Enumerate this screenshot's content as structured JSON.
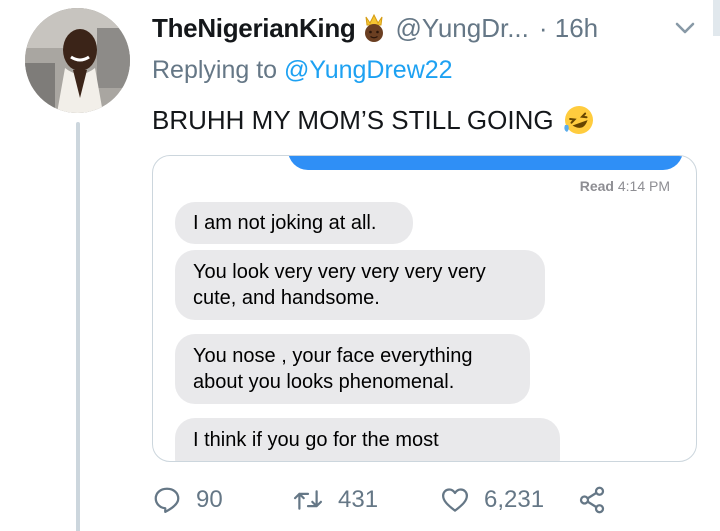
{
  "tweet": {
    "display_name": "TheNigerianKing",
    "name_emoji": "crown-person-emoji",
    "handle": "@YungDr...",
    "time": "· 16h",
    "replying_prefix": "Replying to",
    "replying_to": "@YungDrew22",
    "text": "BRUHH MY MOM’S STILL GOING",
    "text_emoji": "laughing-crying-emoji"
  },
  "screenshot": {
    "read_label": "Read",
    "read_time": "4:14 PM",
    "messages": [
      {
        "lines": [
          "I am not joking at all."
        ]
      },
      {
        "lines": [
          "You look very very very very very",
          "cute, and handsome."
        ]
      },
      {
        "lines": [
          "You nose , your face everything",
          "about you looks phenomenal."
        ]
      },
      {
        "lines": [
          "I think if you go for the most"
        ]
      }
    ]
  },
  "actions": {
    "reply_count": "90",
    "retweet_count": "431",
    "like_count": "6,231"
  },
  "colors": {
    "link": "#1da1f2",
    "secondary_text": "#657786",
    "imessage_blue": "#2f8ff6",
    "imessage_gray": "#e9e9eb",
    "thread_line": "#ccd6dd"
  }
}
